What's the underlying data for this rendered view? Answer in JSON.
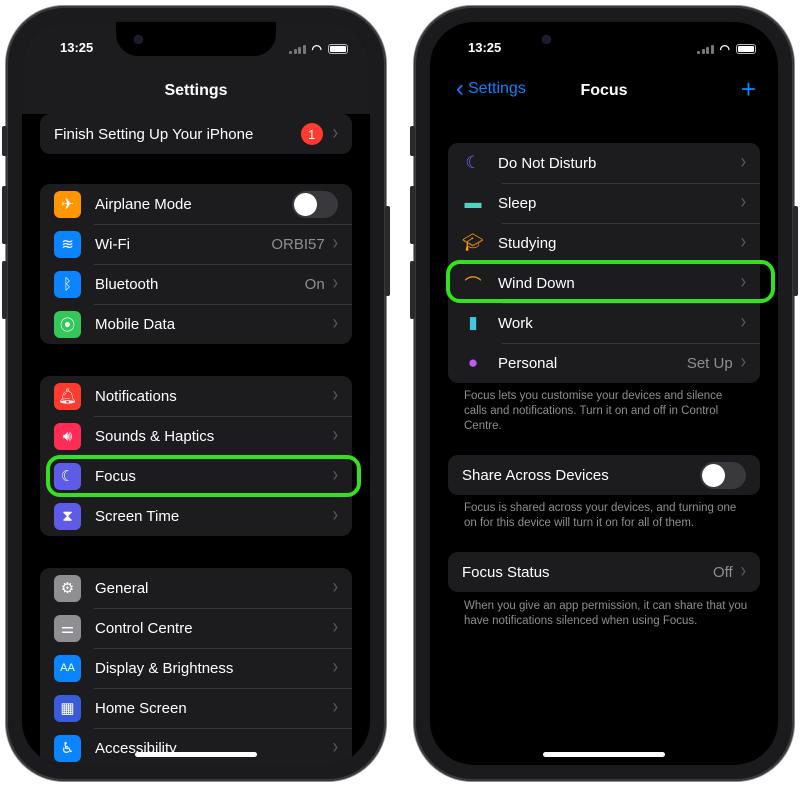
{
  "left_phone": {
    "status": {
      "time": "13:25"
    },
    "title": "Settings",
    "setup": {
      "label": "Finish Setting Up Your iPhone",
      "badge": "1"
    },
    "group1": [
      {
        "label": "Airplane Mode",
        "icon": "airplane-icon",
        "color": "#ff9500",
        "glyph": "✈",
        "toggle": true
      },
      {
        "label": "Wi-Fi",
        "icon": "wifi-icon",
        "color": "#0a84ff",
        "glyph": "≋",
        "value": "ORBI57"
      },
      {
        "label": "Bluetooth",
        "icon": "bluetooth-icon",
        "color": "#0a84ff",
        "glyph": "ᛒ",
        "value": "On"
      },
      {
        "label": "Mobile Data",
        "icon": "antenna-icon",
        "color": "#34c759",
        "glyph": "⦿"
      }
    ],
    "group2": [
      {
        "label": "Notifications",
        "icon": "bell-icon",
        "color": "#ff3b30",
        "glyph": "🔔︎"
      },
      {
        "label": "Sounds & Haptics",
        "icon": "speaker-icon",
        "color": "#ff2d55",
        "glyph": "🔊︎"
      },
      {
        "label": "Focus",
        "icon": "moon-icon",
        "color": "#5e5ce6",
        "glyph": "☾"
      },
      {
        "label": "Screen Time",
        "icon": "hourglass-icon",
        "color": "#5e5ce6",
        "glyph": "⧗"
      }
    ],
    "group3": [
      {
        "label": "General",
        "icon": "gear-icon",
        "color": "#8e8e93",
        "glyph": "⚙"
      },
      {
        "label": "Control Centre",
        "icon": "switches-icon",
        "color": "#8e8e93",
        "glyph": "⚌"
      },
      {
        "label": "Display & Brightness",
        "icon": "text-size-icon",
        "color": "#0a84ff",
        "glyph": "AA"
      },
      {
        "label": "Home Screen",
        "icon": "grid-icon",
        "color": "#3a5bd9",
        "glyph": "▦"
      },
      {
        "label": "Accessibility",
        "icon": "accessibility-icon",
        "color": "#0a84ff",
        "glyph": "♿︎"
      }
    ]
  },
  "right_phone": {
    "status": {
      "time": "13:25"
    },
    "back_label": "Settings",
    "title": "Focus",
    "add_label": "+",
    "modes": [
      {
        "label": "Do Not Disturb",
        "icon": "moon-icon",
        "color": "#6b6bff",
        "glyph": "☾"
      },
      {
        "label": "Sleep",
        "icon": "bed-icon",
        "color": "#4fd1c5",
        "glyph": "▬"
      },
      {
        "label": "Studying",
        "icon": "graduation-cap-icon",
        "color": "#ff9f0a",
        "glyph": "🎓︎"
      },
      {
        "label": "Wind Down",
        "icon": "sunset-icon",
        "color": "#ff9f0a",
        "glyph": "⌒"
      },
      {
        "label": "Work",
        "icon": "id-badge-icon",
        "color": "#40c8e0",
        "glyph": "▮"
      },
      {
        "label": "Personal",
        "icon": "person-icon",
        "color": "#bf5af2",
        "glyph": "●",
        "value": "Set Up"
      }
    ],
    "modes_footer": "Focus lets you customise your devices and silence calls and notifications. Turn it on and off in Control Centre.",
    "share": {
      "label": "Share Across Devices"
    },
    "share_footer": "Focus is shared across your devices, and turning one on for this device will turn it on for all of them.",
    "status_row": {
      "label": "Focus Status",
      "value": "Off"
    },
    "status_footer": "When you give an app permission, it can share that you have notifications silenced when using Focus."
  }
}
